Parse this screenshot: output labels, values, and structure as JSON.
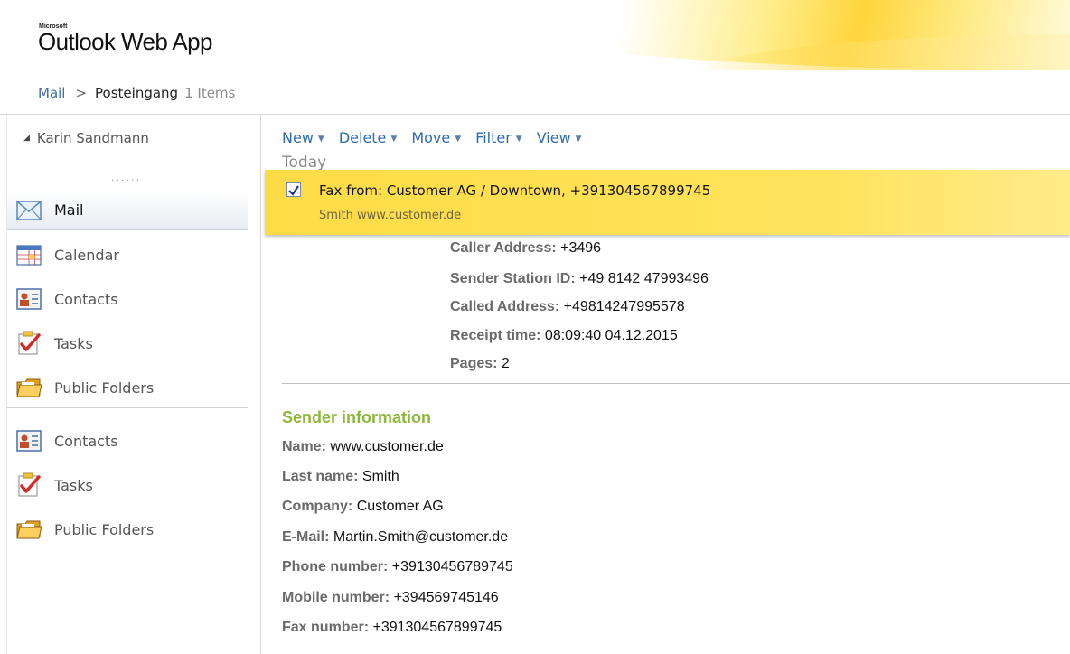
{
  "header": {
    "brand_small": "Microsoft",
    "brand": "Outlook Web App"
  },
  "breadcrumb": {
    "root": "Mail",
    "separator": ">",
    "folder": "Posteingang",
    "count": "1 Items"
  },
  "sidebar": {
    "user": "Karin Sandmann",
    "dots": "......",
    "items": [
      {
        "label": "Mail",
        "icon": "mail-icon"
      },
      {
        "label": "Calendar",
        "icon": "calendar-icon"
      },
      {
        "label": "Contacts",
        "icon": "contacts-icon"
      },
      {
        "label": "Tasks",
        "icon": "tasks-icon"
      },
      {
        "label": "Public Folders",
        "icon": "public-folders-icon"
      }
    ],
    "secondary": [
      {
        "label": "Contacts",
        "icon": "contacts-icon"
      },
      {
        "label": "Tasks",
        "icon": "tasks-icon"
      },
      {
        "label": "Public Folders",
        "icon": "public-folders-icon"
      }
    ]
  },
  "toolbar": {
    "new": "New",
    "delete": "Delete",
    "move": "Move",
    "filter": "Filter",
    "view": "View"
  },
  "list": {
    "group": "Today",
    "message": {
      "subject": "Fax from: Customer AG / Downtown, +391304567899745",
      "sender": "Smith www.customer.de"
    }
  },
  "reading": {
    "fax_info": [
      {
        "label": "Caller Address:",
        "value": "+3496"
      },
      {
        "label": "Sender Station ID:",
        "value": "+49 8142 47993496"
      },
      {
        "label": "Called Address:",
        "value": "+49814247995578"
      },
      {
        "label": "Receipt time:",
        "value": "08:09:40 04.12.2015"
      },
      {
        "label": "Pages:",
        "value": "2"
      }
    ],
    "sender_heading": "Sender information",
    "sender": [
      {
        "label": "Name:",
        "value": "www.customer.de"
      },
      {
        "label": "Last name:",
        "value": "Smith"
      },
      {
        "label": "Company:",
        "value": "Customer AG"
      },
      {
        "label": "E-Mail:",
        "value": "Martin.Smith@customer.de"
      },
      {
        "label": "Phone number:",
        "value": "+39130456789745"
      },
      {
        "label": "Mobile number:",
        "value": "+394569745146"
      },
      {
        "label": "Fax number:",
        "value": "+391304567899745"
      }
    ]
  },
  "colors": {
    "accent": "#2e6bb3",
    "highlight": "#ffdc46",
    "section_heading": "#8cb83a"
  }
}
